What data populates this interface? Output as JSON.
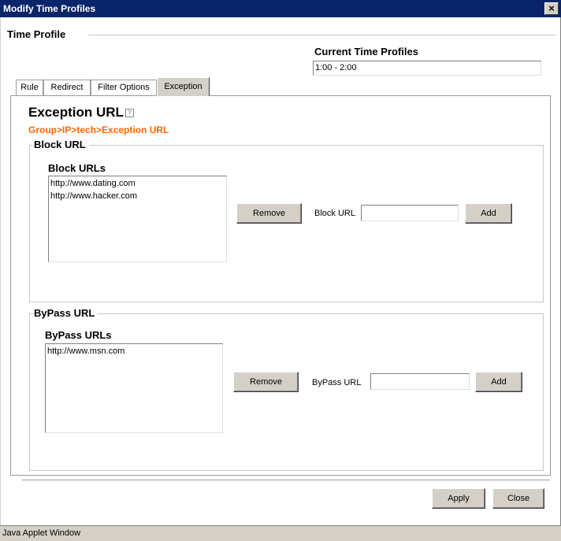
{
  "window": {
    "title": "Modify Time Profiles",
    "close_glyph": "×"
  },
  "time_profile": {
    "heading": "Time Profile",
    "current_label": "Current Time Profiles",
    "current_value": "1:00 - 2:00"
  },
  "tabs": [
    {
      "label": "Rule"
    },
    {
      "label": "Redirect"
    },
    {
      "label": "Filter Options"
    },
    {
      "label": "Exception",
      "active": true
    }
  ],
  "exception": {
    "title": "Exception URL",
    "help_glyph": "?",
    "breadcrumb": "Group>IP>tech>Exception URL",
    "breadcrumb_color": "#ff6600"
  },
  "block": {
    "group_label": "Block URL",
    "list_label": "Block URLs",
    "items": [
      "http://www.dating.com",
      "http://www.hacker.com"
    ],
    "remove_label": "Remove",
    "field_label": "Block URL",
    "field_value": "",
    "add_label": "Add"
  },
  "bypass": {
    "group_label": "ByPass URL",
    "list_label": "ByPass URLs",
    "items": [
      "http://www.msn.com"
    ],
    "remove_label": "Remove",
    "field_label": "ByPass URL",
    "field_value": "",
    "add_label": "Add"
  },
  "footer": {
    "apply_label": "Apply",
    "close_label": "Close"
  },
  "status": {
    "text": "Java Applet Window"
  }
}
